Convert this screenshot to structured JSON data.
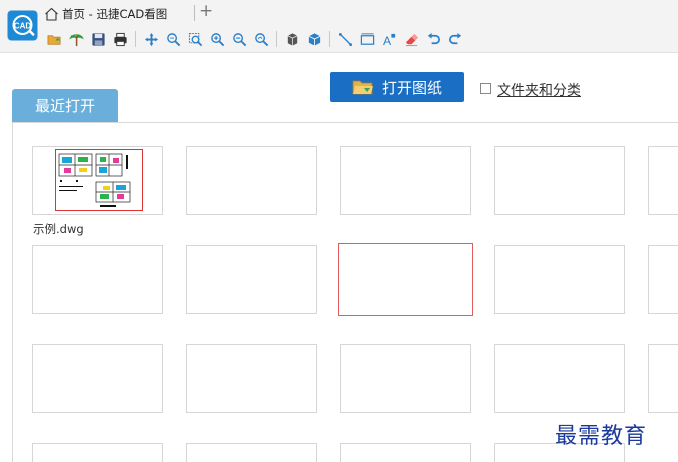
{
  "app": {
    "home_tab": "首页 - 迅捷CAD看图",
    "new_tab_symbol": "+"
  },
  "toolbar": {
    "icons": [
      "open-file-icon",
      "tree-icon",
      "save-icon",
      "print-icon",
      "pan-icon",
      "zoom-window-icon",
      "zoom-extents-icon",
      "zoom-in-icon",
      "zoom-out-icon",
      "zoom-previous-icon",
      "3d-box-icon",
      "3d-view-icon",
      "line-measure-icon",
      "area-measure-icon",
      "text-icon",
      "eraser-icon",
      "undo-icon",
      "redo-icon"
    ]
  },
  "main": {
    "open_drawing_label": "打开图纸",
    "folder_category_label": "文件夹和分类",
    "recent_tab_label": "最近打开",
    "file_caption": "示例.dwg"
  },
  "watermark": "最需教育",
  "colors": {
    "accent_blue": "#1a6fc4",
    "tab_blue": "#6aaedc",
    "selected_border": "#e05d5d"
  }
}
